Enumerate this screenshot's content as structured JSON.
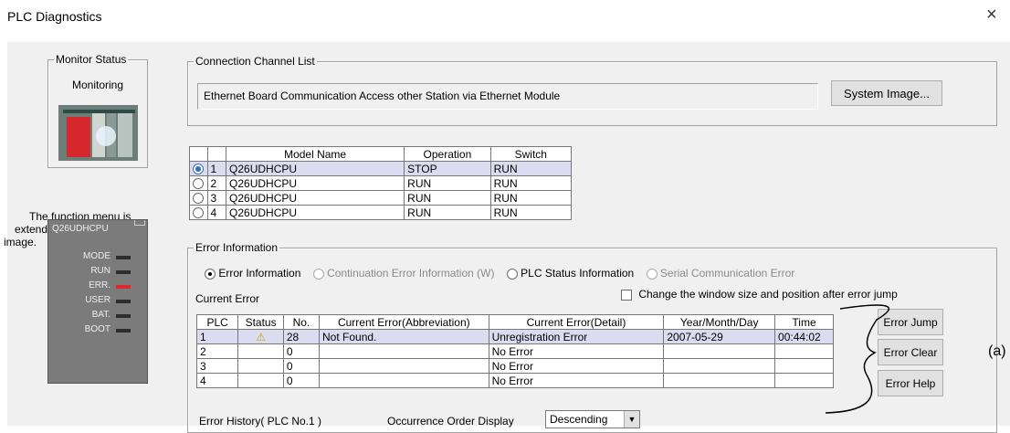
{
  "window": {
    "title": "PLC Diagnostics",
    "close_glyph": "×"
  },
  "monitor_status": {
    "legend": "Monitor Status",
    "state": "Monitoring",
    "hint_lines": [
      "The function menu is",
      "extended from the PLC",
      "image."
    ]
  },
  "plc_panel": {
    "model": "Q26UDHCPU",
    "leds": [
      "MODE",
      "RUN",
      "ERR.",
      "USER",
      "BAT.",
      "BOOT"
    ]
  },
  "connection": {
    "legend": "Connection Channel List",
    "channel_text": "Ethernet Board Communication  Access other Station via Ethernet Module",
    "system_image_button": "System Image..."
  },
  "cpu_table": {
    "headers": [
      "Model Name",
      "Operation",
      "Switch"
    ],
    "rows": [
      {
        "index": "1",
        "model": "Q26UDHCPU",
        "operation": "STOP",
        "switch": "RUN"
      },
      {
        "index": "2",
        "model": "Q26UDHCPU",
        "operation": "RUN",
        "switch": "RUN"
      },
      {
        "index": "3",
        "model": "Q26UDHCPU",
        "operation": "RUN",
        "switch": "RUN"
      },
      {
        "index": "4",
        "model": "Q26UDHCPU",
        "operation": "RUN",
        "switch": "RUN"
      }
    ]
  },
  "error_info": {
    "legend": "Error Information",
    "radio_options": [
      "Error Information",
      "Continuation Error Information (W)",
      "PLC Status Information",
      "Serial Communication Error"
    ],
    "current_error_label": "Current Error",
    "change_window_label": "Change the window size and position after error jump",
    "headers": [
      "PLC",
      "Status",
      "No.",
      "Current Error(Abbreviation)",
      "Current Error(Detail)",
      "Year/Month/Day",
      "Time"
    ],
    "rows": [
      {
        "plc": "1",
        "status": "⚠",
        "no": "28",
        "abbr": "Not Found.",
        "detail": "Unregistration Error",
        "date": "2007-05-29",
        "time": "00:44:02"
      },
      {
        "plc": "2",
        "status": "",
        "no": "0",
        "abbr": "",
        "detail": "No Error",
        "date": "",
        "time": ""
      },
      {
        "plc": "3",
        "status": "",
        "no": "0",
        "abbr": "",
        "detail": "No Error",
        "date": "",
        "time": ""
      },
      {
        "plc": "4",
        "status": "",
        "no": "0",
        "abbr": "",
        "detail": "No Error",
        "date": "",
        "time": ""
      }
    ],
    "buttons": {
      "jump": "Error Jump",
      "clear": "Error Clear",
      "help": "Error Help"
    },
    "history_label": "Error History( PLC No.1 )",
    "order_label": "Occurrence Order Display",
    "order_value": "Descending"
  },
  "annotation": "(a)",
  "colors": {
    "selected_row": "#dcdcf0",
    "err_led": "#e2262d",
    "warning": "#f2d21b"
  }
}
